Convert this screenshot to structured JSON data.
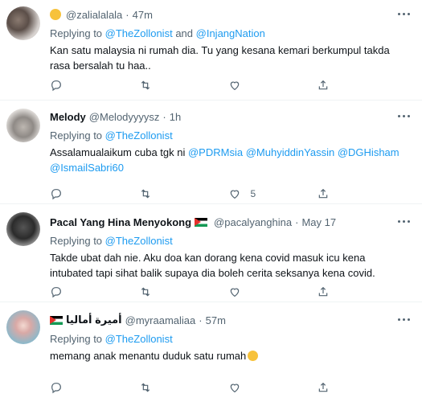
{
  "tweets": [
    {
      "handle": "@zalialalala",
      "time": "47m",
      "reply_prefix": "Replying to",
      "reply_to_1": "@TheZollonist",
      "reply_join": "and",
      "reply_to_2": "@InjangNation",
      "body": "Kan satu malaysia ni rumah dia. Tu yang kesana kemari berkumpul takda rasa bersalah tu haa..",
      "like_count": ""
    },
    {
      "name": "Melody",
      "handle": "@Melodyyyysz",
      "time": "1h",
      "reply_prefix": "Replying to",
      "reply_to": "@TheZollonist",
      "body_prefix": "Assalamualaikum cuba tgk ni",
      "mentions": [
        "@PDRMsia",
        "@MuhyiddinYassin",
        "@DGHisham",
        "@IsmailSabri60"
      ],
      "like_count": "5"
    },
    {
      "name": "Pacal Yang Hina Menyokong",
      "handle": "@pacalyanghina",
      "time": "May 17",
      "reply_prefix": "Replying to",
      "reply_to": "@TheZollonist",
      "body": "Takde ubat dah nie. Aku doa kan dorang kena covid masuk icu kena intubated tapi sihat balik supaya dia boleh cerita seksanya kena covid.",
      "like_count": ""
    },
    {
      "name": "أميرة أماليا",
      "handle": "@myraamaliaa",
      "time": "57m",
      "reply_prefix": "Replying to",
      "reply_to": "@TheZollonist",
      "body": "memang anak menantu duduk satu rumah",
      "like_count": ""
    }
  ],
  "separator": "·",
  "icons": [
    "reply-icon",
    "retweet-icon",
    "like-icon",
    "share-icon",
    "more-icon",
    "flag-icon",
    "emoji-icon"
  ]
}
